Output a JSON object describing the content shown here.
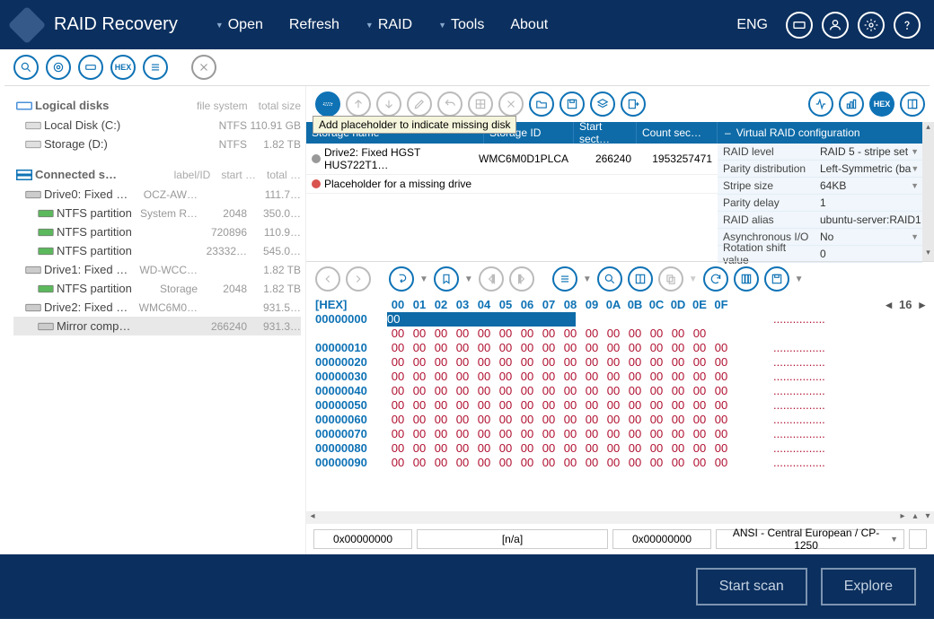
{
  "app": {
    "title": "RAID Recovery",
    "language": "ENG"
  },
  "menu": [
    "Open",
    "Refresh",
    "RAID",
    "Tools",
    "About"
  ],
  "menu_has_dropdown": [
    true,
    false,
    true,
    true,
    false
  ],
  "tooltip": "Add placeholder to indicate missing disk",
  "left": {
    "logical": {
      "title": "Logical disks",
      "cols": [
        "file system",
        "total size"
      ]
    },
    "logical_disks": [
      {
        "name": "Local Disk (C:)",
        "fs": "NTFS",
        "size": "110.91 GB"
      },
      {
        "name": "Storage (D:)",
        "fs": "NTFS",
        "size": "1.82 TB"
      }
    ],
    "connected": {
      "title": "Connected s…",
      "cols": [
        "label/ID",
        "start …",
        "total …"
      ]
    },
    "drives": [
      {
        "name": "Drive0: Fixed …",
        "label": "OCZ-AW…",
        "start": "",
        "size": "111.7…",
        "type": "drive",
        "indent": 1
      },
      {
        "name": "NTFS partition",
        "label": "System R…",
        "start": "2048",
        "size": "350.0…",
        "type": "part",
        "indent": 2
      },
      {
        "name": "NTFS partition",
        "label": "",
        "start": "720896",
        "size": "110.9…",
        "type": "part",
        "indent": 2
      },
      {
        "name": "NTFS partition",
        "label": "",
        "start": "23332…",
        "size": "545.0…",
        "type": "part",
        "indent": 2
      },
      {
        "name": "Drive1: Fixed …",
        "label": "WD-WCC…",
        "start": "",
        "size": "1.82 TB",
        "type": "drive",
        "indent": 1
      },
      {
        "name": "NTFS partition",
        "label": "Storage",
        "start": "2048",
        "size": "1.82 TB",
        "type": "part",
        "indent": 2
      },
      {
        "name": "Drive2: Fixed …",
        "label": "WMC6M0…",
        "start": "",
        "size": "931.5…",
        "type": "drive",
        "indent": 1
      },
      {
        "name": "Mirror compo…",
        "label": "",
        "start": "266240",
        "size": "931.3…",
        "type": "mirror",
        "indent": 2,
        "selected": true
      }
    ]
  },
  "storage": {
    "headers": [
      "Storage name",
      "Storage ID",
      "Start sect…",
      "Count sec…"
    ],
    "rows": [
      {
        "bullet": "grey",
        "name": "Drive2: Fixed HGST HUS722T1…",
        "id": "WMC6M0D1PLCA",
        "start": "266240",
        "count": "1953257471"
      },
      {
        "bullet": "red",
        "name": "Placeholder for a missing drive",
        "id": "",
        "start": "",
        "count": ""
      }
    ]
  },
  "config": {
    "title": "Virtual RAID configuration",
    "rows": [
      {
        "k": "RAID level",
        "v": "RAID 5 - stripe set",
        "dd": true
      },
      {
        "k": "Parity distribution",
        "v": "Left-Symmetric (ba",
        "dd": true
      },
      {
        "k": "Stripe size",
        "v": "64KB",
        "dd": true
      },
      {
        "k": "Parity delay",
        "v": "1",
        "dd": false
      },
      {
        "k": "RAID alias",
        "v": "ubuntu-server:RAID1",
        "dd": false
      },
      {
        "k": "Asynchronous I/O",
        "v": "No",
        "dd": true
      },
      {
        "k": "Rotation shift value",
        "v": "0",
        "dd": false
      }
    ]
  },
  "hex": {
    "label": "[HEX]",
    "cols": [
      "00",
      "01",
      "02",
      "03",
      "04",
      "05",
      "06",
      "07",
      "08",
      "09",
      "0A",
      "0B",
      "0C",
      "0D",
      "0E",
      "0F"
    ],
    "stepper": "16",
    "rows": 10,
    "ascii_row": "................"
  },
  "bottom": {
    "addr1": "0x00000000",
    "mid": "[n/a]",
    "addr2": "0x00000000",
    "encoding": "ANSI - Central European / CP-1250"
  },
  "footer": {
    "scan": "Start scan",
    "explore": "Explore"
  }
}
